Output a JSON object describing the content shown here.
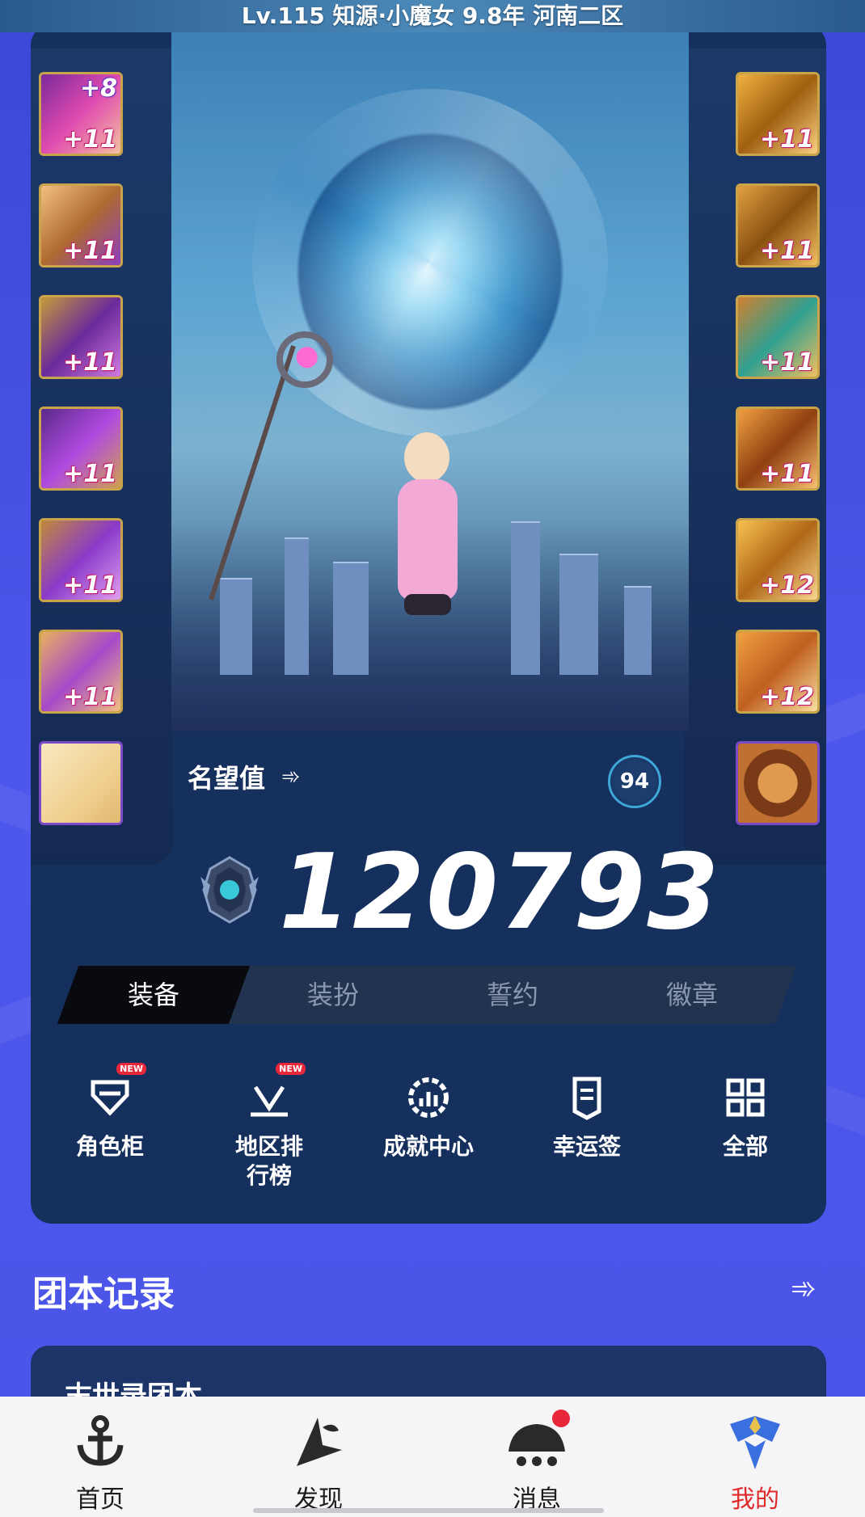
{
  "header": {
    "title": "Lv.115 知源·小魔女 9.8年 河南二区"
  },
  "equipment_left": [
    {
      "icon": "shoulder-armor-icon",
      "enhance": "+11",
      "refine": "+8"
    },
    {
      "icon": "chest-armor-icon",
      "enhance": "+11"
    },
    {
      "icon": "pants-armor-icon",
      "enhance": "+11"
    },
    {
      "icon": "belt-armor-icon",
      "enhance": "+11"
    },
    {
      "icon": "boots-armor-icon",
      "enhance": "+11"
    },
    {
      "icon": "weapon-icon",
      "enhance": "+11"
    },
    {
      "icon": "pet-icon",
      "enhance": ""
    }
  ],
  "equipment_right": [
    {
      "icon": "bracelet-icon",
      "enhance": "+11"
    },
    {
      "icon": "necklace-icon",
      "enhance": "+11"
    },
    {
      "icon": "ring-icon",
      "enhance": "+11"
    },
    {
      "icon": "auxiliary-icon",
      "enhance": "+11"
    },
    {
      "icon": "magic-stone-icon",
      "enhance": "+12"
    },
    {
      "icon": "earring-icon",
      "enhance": "+12"
    },
    {
      "icon": "title-icon",
      "enhance": ""
    }
  ],
  "fame": {
    "label": "名望值",
    "badge": "94",
    "value": "120793"
  },
  "tabs": [
    {
      "label": "装备",
      "active": true
    },
    {
      "label": "装扮",
      "active": false
    },
    {
      "label": "誓约",
      "active": false
    },
    {
      "label": "徽章",
      "active": false
    }
  ],
  "shortcuts": [
    {
      "label": "角色柜",
      "tag": "NEW",
      "icon": "role-cabinet-icon"
    },
    {
      "label": "地区排\n行榜",
      "tag": "NEW",
      "icon": "ranking-icon"
    },
    {
      "label": "成就中心",
      "tag": "",
      "icon": "achievement-icon"
    },
    {
      "label": "幸运签",
      "tag": "",
      "icon": "lucky-draw-icon"
    },
    {
      "label": "全部",
      "tag": "",
      "icon": "grid-icon"
    }
  ],
  "section": {
    "title": "团本记录",
    "record_title": "末世录团本"
  },
  "bottom_nav": [
    {
      "label": "首页",
      "icon": "anchor-icon",
      "active": false
    },
    {
      "label": "发现",
      "icon": "discover-icon",
      "active": false
    },
    {
      "label": "消息",
      "icon": "message-icon",
      "active": false,
      "dot": true
    },
    {
      "label": "我的",
      "icon": "profile-icon",
      "active": true
    }
  ],
  "colors": {
    "background": "#4a55e8",
    "card": "#16305d",
    "active_nav": "#e02a2a",
    "slot_border": "#c9a44a"
  }
}
